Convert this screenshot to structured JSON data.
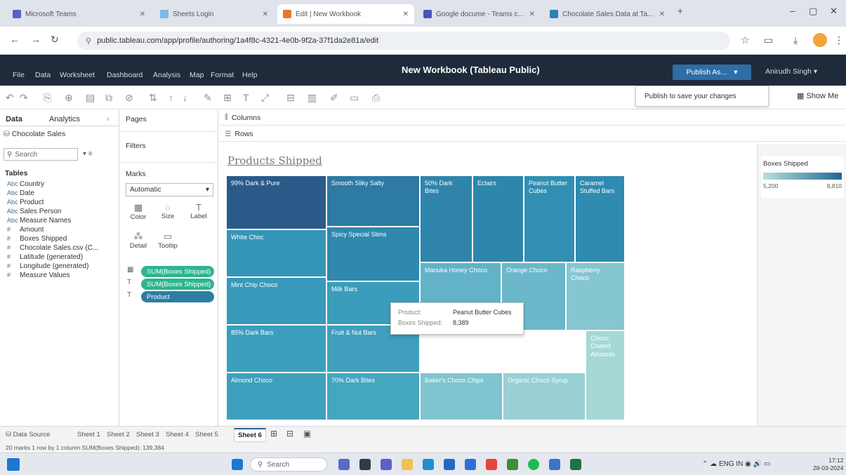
{
  "browser": {
    "tabs": [
      {
        "label": "Microsoft Teams"
      },
      {
        "label": "Sheets Login"
      },
      {
        "label": "Edit | New Workbook",
        "active": true
      },
      {
        "label": "Google docume - Teams classi..."
      },
      {
        "label": "Chocolate Sales Data at Ta..."
      }
    ],
    "url": "public.tableau.com/app/profile/authoring/1a4f8c-4321-4e0b-9f2a-37f1da2e81a/edit"
  },
  "tableau": {
    "menus": [
      "File",
      "Data",
      "Worksheet",
      "Dashboard",
      "Analysis",
      "Map",
      "Format",
      "Help"
    ],
    "workbook_title": "New Workbook (Tableau Public)",
    "publish_label": "Publish As...",
    "user_label": "Anirudh Singh",
    "publish_tooltip": "Publish to save your changes",
    "show_me": "Show Me"
  },
  "data_pane": {
    "tab_data": "Data",
    "tab_analytics": "Analytics",
    "datasource": "Chocolate Sales",
    "search_placeholder": "Search",
    "tables_header": "Tables",
    "fields": [
      {
        "icon": "Abc",
        "name": "Country"
      },
      {
        "icon": "Abc",
        "name": "Date"
      },
      {
        "icon": "Abc",
        "name": "Product"
      },
      {
        "icon": "Abc",
        "name": "Sales Person"
      },
      {
        "icon": "Abc",
        "name": "Measure Names"
      },
      {
        "icon": "#",
        "name": "Amount"
      },
      {
        "icon": "#",
        "name": "Boxes Shipped"
      },
      {
        "icon": "#",
        "name": "Chocolate Sales.csv (C..."
      },
      {
        "icon": "#",
        "name": "Latitude (generated)"
      },
      {
        "icon": "#",
        "name": "Longitude (generated)"
      },
      {
        "icon": "#",
        "name": "Measure Values"
      }
    ]
  },
  "shelves": {
    "pages": "Pages",
    "filters": "Filters",
    "marks": "Marks",
    "mark_type": "Automatic",
    "mark_buttons": [
      {
        "icon": "▦",
        "label": "Color"
      },
      {
        "icon": "◌",
        "label": "Size"
      },
      {
        "icon": "T",
        "label": "Label"
      },
      {
        "icon": "⁂",
        "label": "Detail"
      },
      {
        "icon": "▭",
        "label": "Tooltip"
      }
    ],
    "pills": [
      {
        "icon": "▦",
        "label": "SUM(Boxes Shipped)",
        "color": "#2fb48f"
      },
      {
        "icon": "T",
        "label": "SUM(Boxes Shipped)",
        "color": "#2fb48f"
      },
      {
        "icon": "T",
        "label": "Product",
        "color": "#2d7ea3"
      }
    ],
    "columns": "Columns",
    "rows": "Rows"
  },
  "view": {
    "sheet_title": "Products Shipped",
    "tooltip": {
      "product_key": "Product:",
      "product_value": "Peanut Butter Cubes",
      "boxes_key": "Boxes Shipped:",
      "boxes_value": "8,389"
    }
  },
  "chart_data": {
    "type": "treemap",
    "title": "Products Shipped",
    "measure": "Boxes Shipped",
    "items": [
      {
        "label": "99% Dark & Pure",
        "value": 8810,
        "color": "#2a5a8a"
      },
      {
        "label": "Smooth Sliky Salty",
        "value": 8180,
        "color": "#2d7aa5"
      },
      {
        "label": "50% Dark Bites",
        "value": 7900,
        "color": "#2f84ac"
      },
      {
        "label": "Eclairs",
        "value": 7850,
        "color": "#2e86ad"
      },
      {
        "label": "Peanut Butter Cubes",
        "value": 8389,
        "color": "#318fb3"
      },
      {
        "label": "Caramel Stuffed Bars",
        "value": 7700,
        "color": "#2f8bb0"
      },
      {
        "label": "White Choc",
        "value": 7320,
        "color": "#3595b7"
      },
      {
        "label": "Spicy Special Slims",
        "value": 7280,
        "color": "#2f88ae"
      },
      {
        "label": "Mint Chip Choco",
        "value": 7250,
        "color": "#3899ba"
      },
      {
        "label": "Milk Bars",
        "value": 7100,
        "color": "#3a9dbc"
      },
      {
        "label": "85% Dark Bars",
        "value": 6930,
        "color": "#3c9fbd"
      },
      {
        "label": "Fruit & Nut Bars",
        "value": 6700,
        "color": "#3f9fbd"
      },
      {
        "label": "Almond Choco",
        "value": 6550,
        "color": "#3fa0bd"
      },
      {
        "label": "70% Dark Bites",
        "value": 6400,
        "color": "#45a6c0"
      },
      {
        "label": "Manuka Honey Choco",
        "value": 6200,
        "color": "#62b3c8"
      },
      {
        "label": "Orange Choco",
        "value": 6000,
        "color": "#6bb8ca"
      },
      {
        "label": "Raspberry Choco",
        "value": 5900,
        "color": "#86c6d1"
      },
      {
        "label": "Baker's Choco Chips",
        "value": 5700,
        "color": "#7fc4cf"
      },
      {
        "label": "Organic Choco Syrup",
        "value": 5600,
        "color": "#98d0d6"
      },
      {
        "label": "Choco Coated Almonds",
        "value": 5200,
        "color": "#a6d8d6"
      }
    ],
    "legend": {
      "title": "Boxes Shipped",
      "min_label": "5,200",
      "max_label": "8,810"
    }
  },
  "sheet_tabs": {
    "datasource_tab": "Data Source",
    "sheets": [
      "Sheet 1",
      "Sheet 2",
      "Sheet 3",
      "Sheet 4",
      "Sheet 5",
      "Sheet 6"
    ],
    "active_sheet": "Sheet 6",
    "status": "20 marks  1 row by 1 column  SUM(Boxes Shipped): 139,384"
  },
  "taskbar": {
    "search_label": "Search",
    "tray": "ENG IN",
    "time": "17:12",
    "date": "28-03-2024"
  }
}
